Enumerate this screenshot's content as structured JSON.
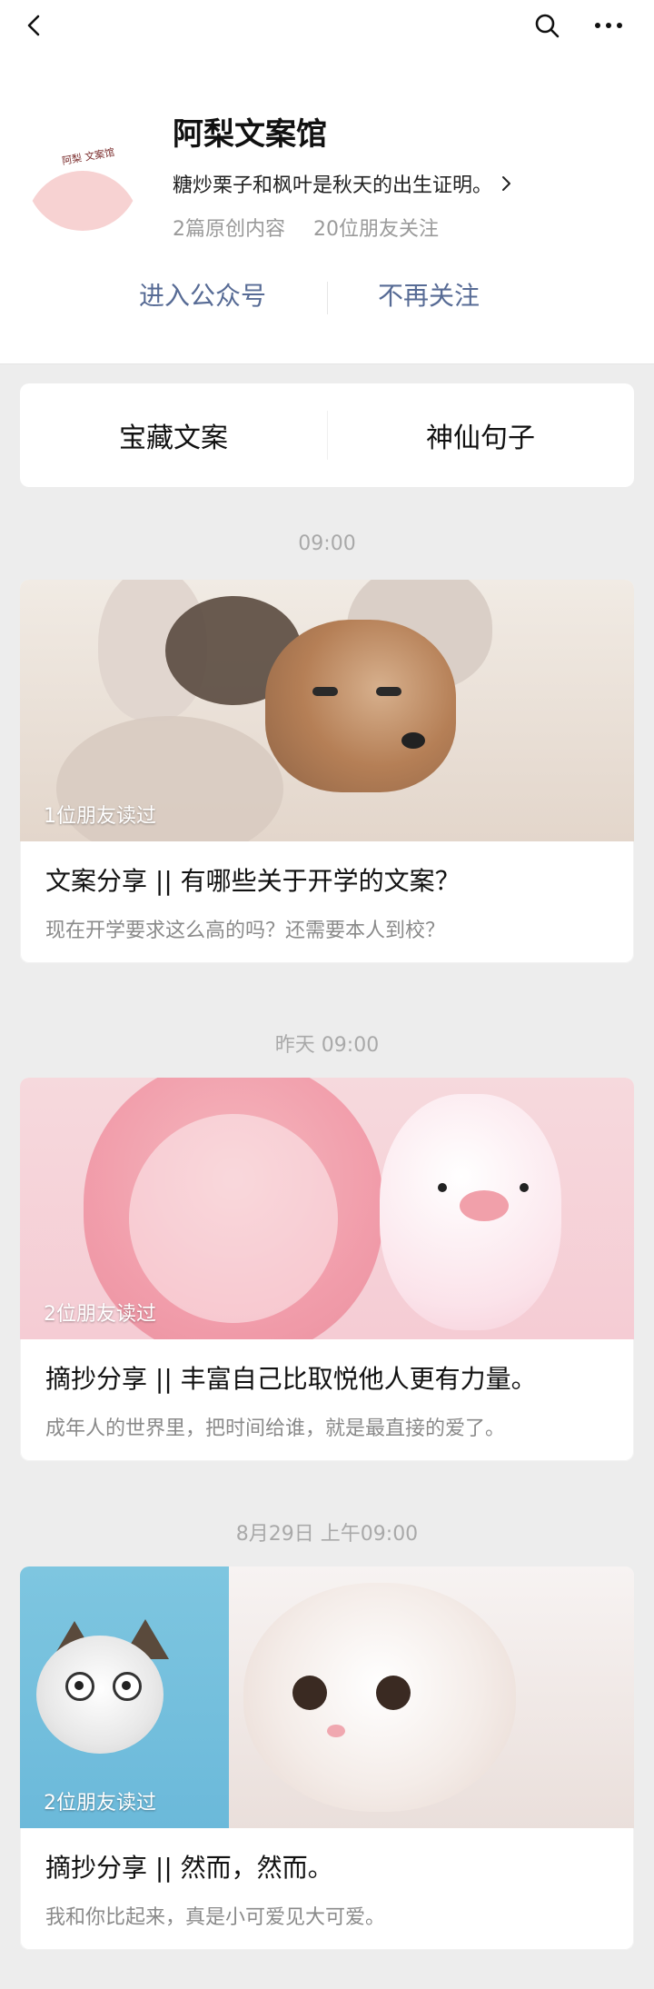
{
  "topbar": {
    "back_icon": "chevron-left-icon",
    "search_icon": "search-icon",
    "more_icon": "more-icon"
  },
  "account": {
    "name": "阿梨文案馆",
    "description": "糖炒栗子和枫叶是秋天的出生证明。",
    "stats": {
      "original": "2篇原创内容",
      "followers": "20位朋友关注"
    },
    "actions": {
      "enter": "进入公众号",
      "unfollow": "不再关注"
    },
    "avatar_logo_text": "阿梨\n文案馆"
  },
  "tabs": [
    {
      "label": "宝藏文案"
    },
    {
      "label": "神仙句子"
    }
  ],
  "feed": [
    {
      "time": "09:00",
      "readers": "1位朋友读过",
      "title": "文案分享 || 有哪些关于开学的文案？",
      "summary": "现在开学要求这么高的吗？还需要本人到校？"
    },
    {
      "time": "昨天 09:00",
      "readers": "2位朋友读过",
      "title": "摘抄分享 || 丰富自己比取悦他人更有力量。",
      "summary": "成年人的世界里，把时间给谁，就是最直接的爱了。"
    },
    {
      "time": "8月29日 上午09:00",
      "readers": "2位朋友读过",
      "title": "摘抄分享 || 然而，然而。",
      "summary": "我和你比起来，真是小可爱见大可爱。"
    }
  ],
  "colors": {
    "link": "#576b95",
    "muted": "#9a9a9a",
    "background": "#ededed"
  }
}
